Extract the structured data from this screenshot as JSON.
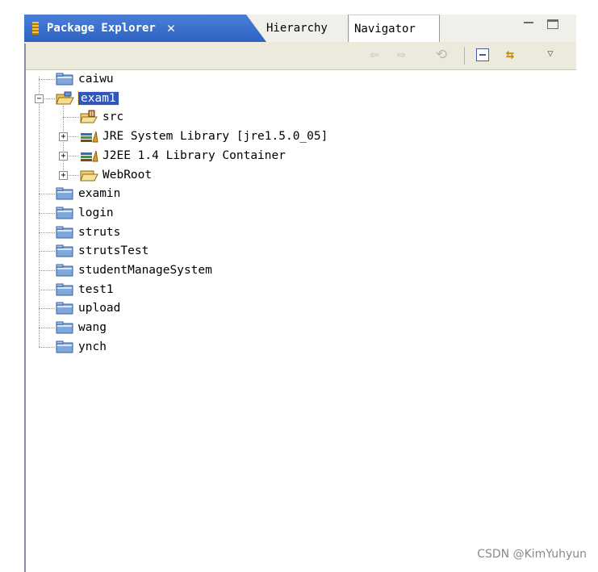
{
  "tabs": {
    "active_label": "Package Explorer",
    "close_glyph": "✕",
    "hierarchy_label": "Hierarchy",
    "navigator_label": "Navigator"
  },
  "toolbar": {
    "back_icon": "⇦",
    "forward_icon": "⇨",
    "home_icon": "⟲",
    "link_icon": "⇆",
    "menu_icon": "▽"
  },
  "tree": {
    "items": [
      {
        "label": "caiwu",
        "icon": "project-folder-icon"
      },
      {
        "label": "exam1",
        "icon": "open-project-folder-icon",
        "expanded": true,
        "selected": true
      },
      {
        "label": "src",
        "icon": "source-folder-icon"
      },
      {
        "label": "JRE System Library [jre1.5.0_05]",
        "icon": "library-icon"
      },
      {
        "label": "J2EE 1.4 Library Container",
        "icon": "library-icon"
      },
      {
        "label": "WebRoot",
        "icon": "folder-icon"
      },
      {
        "label": "examin",
        "icon": "project-folder-icon"
      },
      {
        "label": "login",
        "icon": "project-folder-icon"
      },
      {
        "label": "struts",
        "icon": "project-folder-icon"
      },
      {
        "label": "strutsTest",
        "icon": "project-folder-icon"
      },
      {
        "label": "studentManageSystem",
        "icon": "project-folder-icon"
      },
      {
        "label": "test1",
        "icon": "project-folder-icon"
      },
      {
        "label": "upload",
        "icon": "project-folder-icon"
      },
      {
        "label": "wang",
        "icon": "project-folder-icon"
      },
      {
        "label": "ynch",
        "icon": "project-folder-icon"
      }
    ],
    "expander_plus": "+",
    "expander_minus": "−"
  },
  "watermark": "CSDN @KimYuhyun"
}
